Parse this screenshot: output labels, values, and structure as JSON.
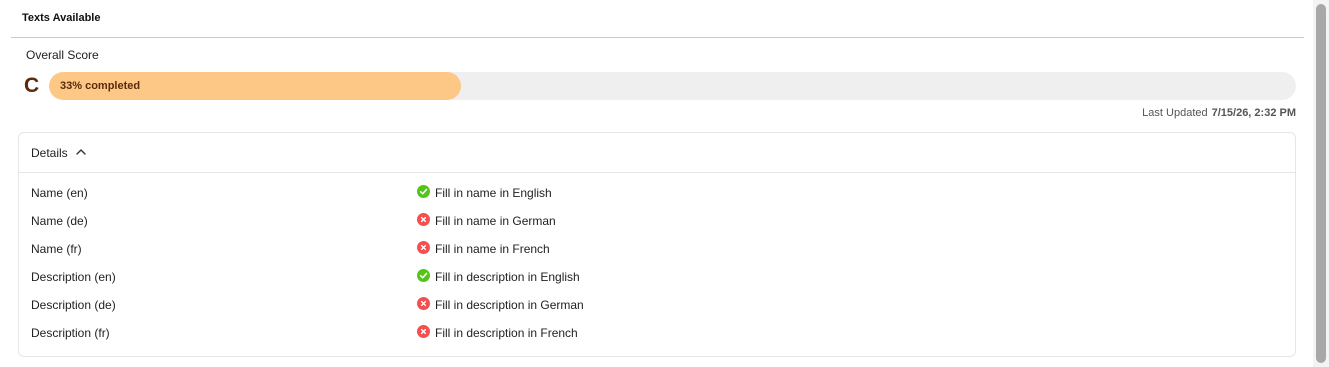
{
  "panel": {
    "title": "Texts Available"
  },
  "score": {
    "label": "Overall Score",
    "grade": "C",
    "progress_percent": 33,
    "progress_text": "33% completed",
    "fill_color": "#fdc885",
    "grade_color": "#5a2a0c"
  },
  "last_updated": {
    "label": "Last Updated",
    "value": "7/15/26, 2:32 PM"
  },
  "details": {
    "title": "Details",
    "expanded": true,
    "rows": [
      {
        "label": "Name (en)",
        "status": "ok",
        "icon": "check-circle-icon",
        "message": "Fill in name in English"
      },
      {
        "label": "Name (de)",
        "status": "error",
        "icon": "x-circle-icon",
        "message": "Fill in name in German"
      },
      {
        "label": "Name (fr)",
        "status": "error",
        "icon": "x-circle-icon",
        "message": "Fill in name in French"
      },
      {
        "label": "Description (en)",
        "status": "ok",
        "icon": "check-circle-icon",
        "message": "Fill in description in English"
      },
      {
        "label": "Description (de)",
        "status": "error",
        "icon": "x-circle-icon",
        "message": "Fill in description in German"
      },
      {
        "label": "Description (fr)",
        "status": "error",
        "icon": "x-circle-icon",
        "message": "Fill in description in French"
      }
    ]
  },
  "colors": {
    "ok": "#52c41a",
    "error": "#f5504f"
  }
}
